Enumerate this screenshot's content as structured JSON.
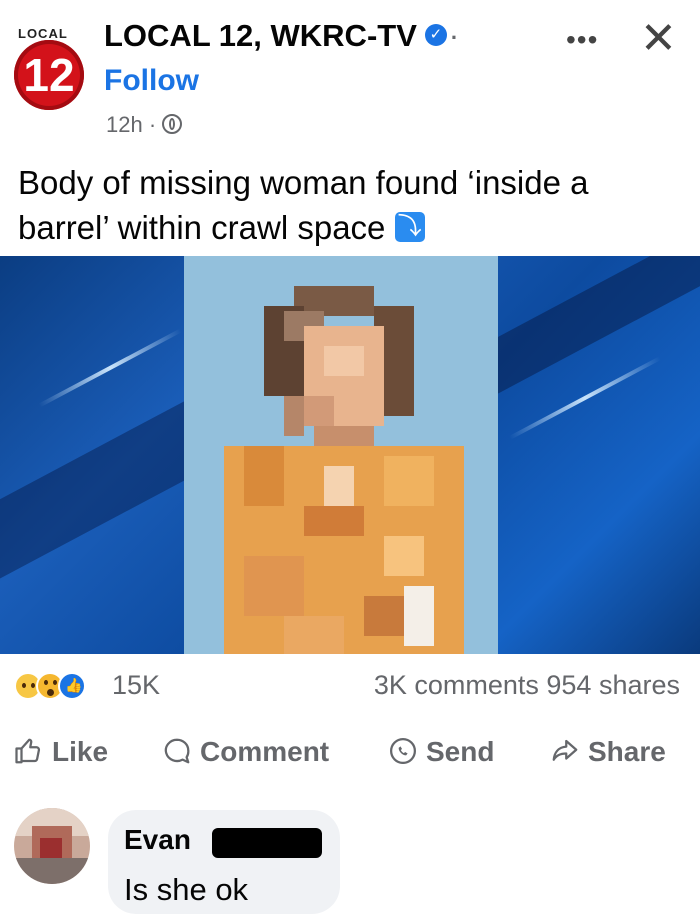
{
  "post": {
    "page_name": "LOCAL 12, WKRC-TV",
    "follow_label": "Follow",
    "logo_text": "LOCAL",
    "logo_number": "12",
    "time": "12h",
    "meta_sep": "·",
    "more_label": "•••",
    "close_label": "✕",
    "caption": "Body of missing woman found ‘inside a barrel’ within crawl space"
  },
  "stats": {
    "reaction_count": "15K",
    "comments_shares": "3K comments  954 shares"
  },
  "actions": {
    "like": "Like",
    "comment": "Comment",
    "send": "Send",
    "share": "Share"
  },
  "comment": {
    "author": "Evan",
    "text": "Is she ok"
  },
  "colors": {
    "brand_blue": "#1b74e4",
    "logo_red": "#d3121a",
    "media_blue": "#1a5db8"
  }
}
